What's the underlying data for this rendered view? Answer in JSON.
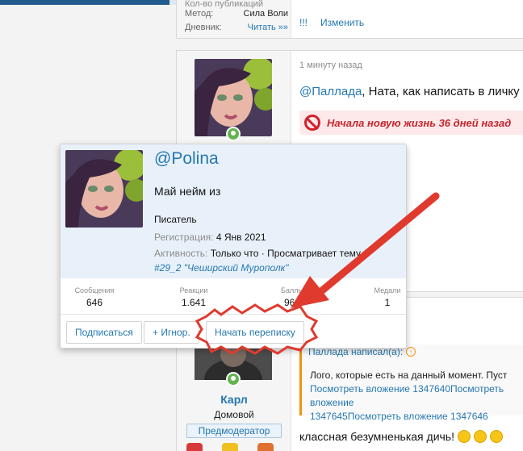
{
  "post1": {
    "meta_clipped": "Кол-во публикаций",
    "method_label": "Метод:",
    "method_value": "Сила Воли",
    "diary_label": "Дневник:",
    "diary_value": "Читать »»",
    "actions": [
      "!!!",
      "Изменить"
    ]
  },
  "post2": {
    "time": "1 минуту назад",
    "mention": "@Паллада",
    "text": ", Ната, как написать в личку",
    "notice": "Начала новую жизнь 36 дней назад"
  },
  "post3": {
    "quote_author": "Паллада написал(а):",
    "quote_icon": "↑",
    "quote_line1": "Лого, которые есть на данный момент. Пуст",
    "quote_line2": "Посмотреть вложение 1347640Посмотреть вложение",
    "quote_line3": "1347645Посмотреть вложение 1347646",
    "reply": "классная безумненькая дичь!",
    "username": "Карл",
    "user_title": "Домовой",
    "user_banner": "Предмодератор"
  },
  "tooltip": {
    "name": "@Polina",
    "status": "Май нейм из",
    "title": "Писатель",
    "reg_label": "Регистрация:",
    "reg_value": "4 Янв 2021",
    "activity_label": "Активность:",
    "activity_value": "Только что · Просматривает тему",
    "activity_thread": "#29_2 \"Чеширский Мурополк\"",
    "stats": [
      {
        "label": "Сообщения",
        "value": "646"
      },
      {
        "label": "Реакции",
        "value": "1.641"
      },
      {
        "label": "Баллы",
        "value": "960"
      },
      {
        "label": "Медали",
        "value": "1"
      }
    ],
    "buttons": {
      "follow": "Подписаться",
      "ignore": "+ Игнор.",
      "conversation": "Начать переписку"
    }
  },
  "colors": {
    "link": "#2577b1",
    "online": "#63b450",
    "annotation": "#e03a2f",
    "tooltip_header": "#e8f1fa"
  }
}
